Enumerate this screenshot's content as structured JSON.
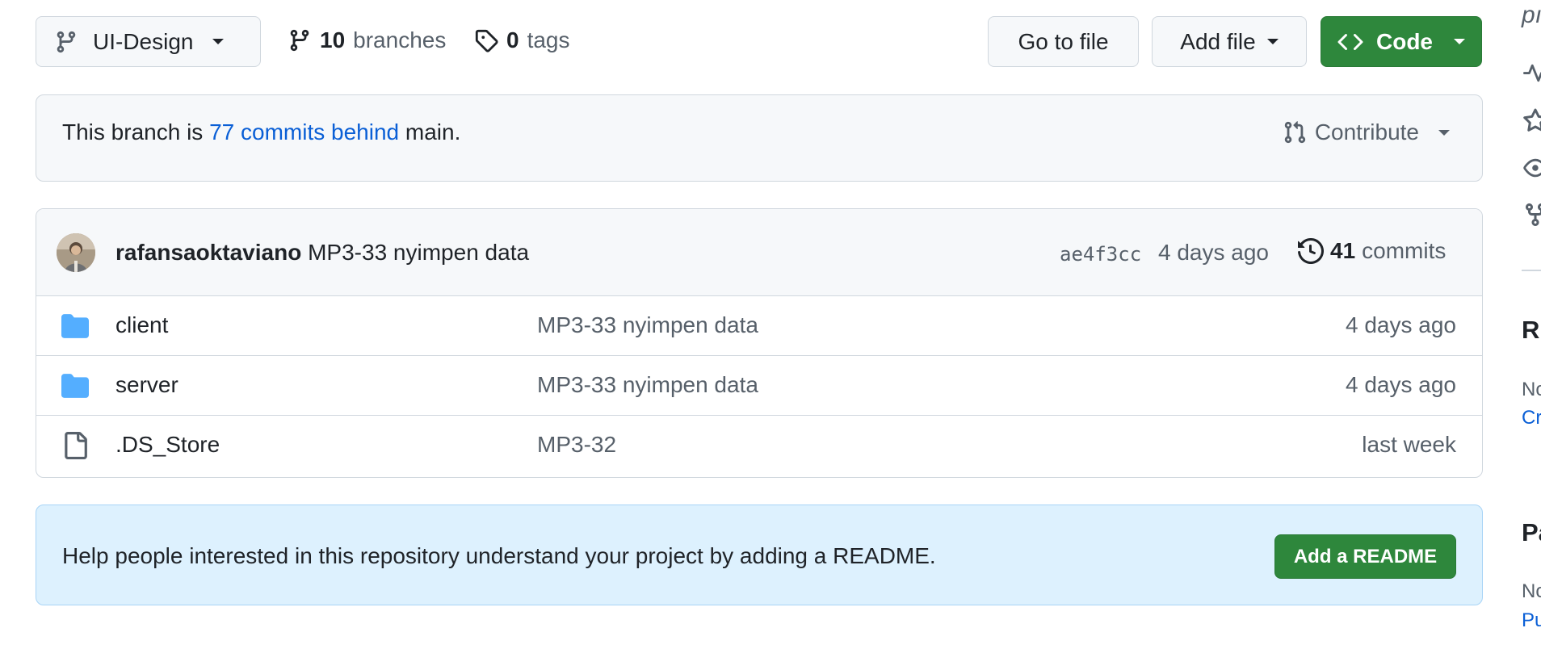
{
  "toolbar": {
    "branch_label": "UI-Design",
    "branches_count": "10",
    "branches_label": "branches",
    "tags_count": "0",
    "tags_label": "tags",
    "go_to_file_label": "Go to file",
    "add_file_label": "Add file",
    "code_label": "Code"
  },
  "notice": {
    "prefix": "This branch is",
    "link": "77 commits behind",
    "suffix": "main.",
    "contribute_label": "Contribute"
  },
  "latest_commit": {
    "author": "rafansaoktaviano",
    "message": "MP3-33 nyimpen data",
    "sha": "ae4f3cc",
    "age": "4 days ago",
    "commits_count": "41",
    "commits_label": "commits"
  },
  "files": [
    {
      "name": "client",
      "type": "folder",
      "message": "MP3-33 nyimpen data",
      "age": "4 days ago"
    },
    {
      "name": "server",
      "type": "folder",
      "message": "MP3-33 nyimpen data",
      "age": "4 days ago"
    },
    {
      "name": ".DS_Store",
      "type": "file",
      "message": "MP3-32",
      "age": "last week"
    }
  ],
  "readme": {
    "text": "Help people interested in this repository understand your project by adding a README.",
    "button_label": "Add a README"
  },
  "sidebar": {
    "about_fragment": "pı",
    "section1_heading": "R",
    "section1_text": "No",
    "section1_link": "Cr",
    "section2_heading": "Pa",
    "section2_text": "No",
    "section2_link": "Pu"
  },
  "colors": {
    "accent_green": "#2e873c",
    "link_blue": "#0a5fd6",
    "folder_blue": "#54aeff",
    "readme_bg": "#ddf1fe"
  }
}
